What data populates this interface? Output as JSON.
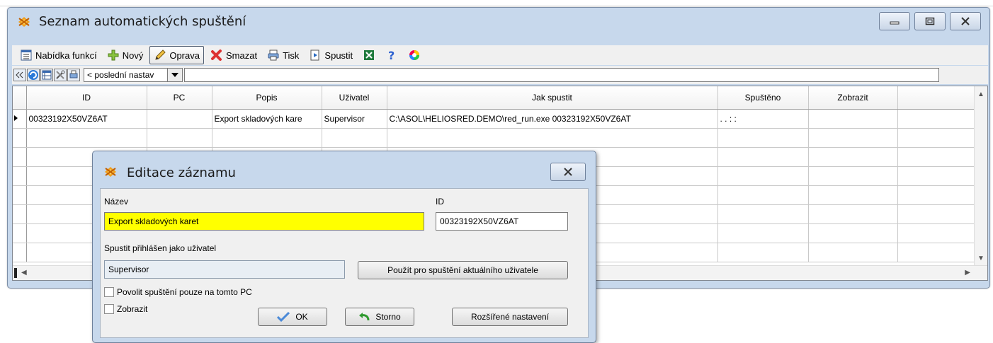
{
  "window": {
    "title": "Seznam automatických spuštění"
  },
  "toolbar": {
    "items": [
      {
        "label": "Nabídka funkcí",
        "icon": "menu-list-icon"
      },
      {
        "label": "Nový",
        "icon": "plus-icon"
      },
      {
        "label": "Oprava",
        "icon": "pencil-icon",
        "pressed": true
      },
      {
        "label": "Smazat",
        "icon": "delete-x-icon"
      },
      {
        "label": "Tisk",
        "icon": "printer-icon"
      },
      {
        "label": "Spustit",
        "icon": "run-icon"
      }
    ],
    "extra_icons": [
      "excel-icon",
      "help-icon",
      "color-wheel-icon"
    ]
  },
  "filter": {
    "selected": "< poslední nastav",
    "input_value": ""
  },
  "grid": {
    "columns": [
      "ID",
      "PC",
      "Popis",
      "Uživatel",
      "Jak spustit",
      "Spuštěno",
      "Zobrazit"
    ],
    "rows": [
      {
        "id": "00323192X50VZ6AT",
        "pc": "",
        "popis": "Export skladových kare",
        "uzivatel": "Supervisor",
        "jak_spustit": "C:\\ASOL\\HELIOSRED.DEMO\\red_run.exe 00323192X50VZ6AT",
        "spusteno": ". .       : :",
        "zobrazit": ""
      }
    ]
  },
  "dialog": {
    "title": "Editace záznamu",
    "nazev_label": "Název",
    "nazev_value": "Export skladových karet",
    "id_label": "ID",
    "id_value": "00323192X50VZ6AT",
    "user_label": "Spustit přihlášen jako uživatel",
    "user_value": "Supervisor",
    "use_current_user_button": "Použít pro spuštění aktuálního uživatele",
    "allow_pc_only_label": "Povolit spuštění pouze na tomto PC",
    "show_label": "Zobrazit",
    "ok_button": "OK",
    "cancel_button": "Storno",
    "advanced_button": "Rozšířené nastavení"
  },
  "colors": {
    "window_frame": "#c7d8ec",
    "toolbar_bg": "#f0f0f0",
    "name_field_highlight": "#ffff00"
  }
}
